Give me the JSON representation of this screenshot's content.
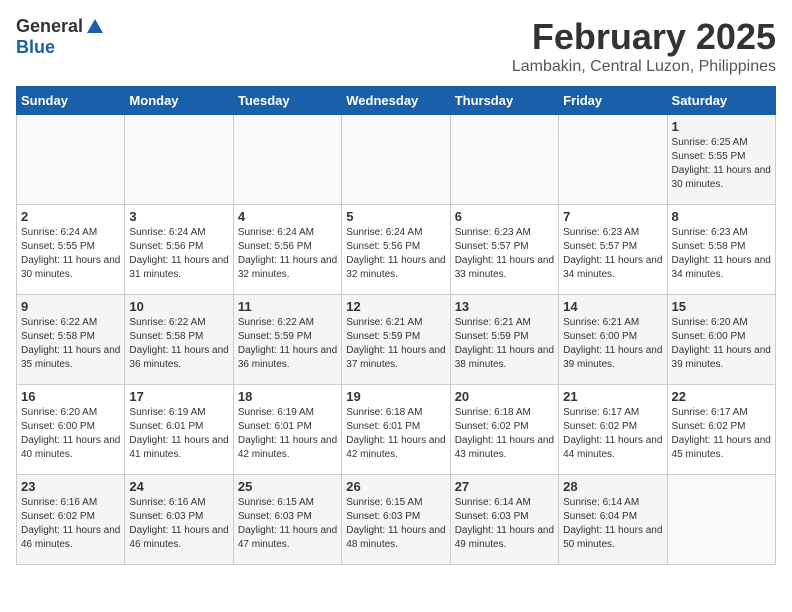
{
  "header": {
    "logo_general": "General",
    "logo_blue": "Blue",
    "month": "February 2025",
    "location": "Lambakin, Central Luzon, Philippines"
  },
  "days_of_week": [
    "Sunday",
    "Monday",
    "Tuesday",
    "Wednesday",
    "Thursday",
    "Friday",
    "Saturday"
  ],
  "weeks": [
    [
      {
        "day": "",
        "sunrise": "",
        "sunset": "",
        "daylight": ""
      },
      {
        "day": "",
        "sunrise": "",
        "sunset": "",
        "daylight": ""
      },
      {
        "day": "",
        "sunrise": "",
        "sunset": "",
        "daylight": ""
      },
      {
        "day": "",
        "sunrise": "",
        "sunset": "",
        "daylight": ""
      },
      {
        "day": "",
        "sunrise": "",
        "sunset": "",
        "daylight": ""
      },
      {
        "day": "",
        "sunrise": "",
        "sunset": "",
        "daylight": ""
      },
      {
        "day": "1",
        "sunrise": "6:25 AM",
        "sunset": "5:55 PM",
        "daylight": "11 hours and 30 minutes."
      }
    ],
    [
      {
        "day": "2",
        "sunrise": "6:24 AM",
        "sunset": "5:55 PM",
        "daylight": "11 hours and 30 minutes."
      },
      {
        "day": "3",
        "sunrise": "6:24 AM",
        "sunset": "5:56 PM",
        "daylight": "11 hours and 31 minutes."
      },
      {
        "day": "4",
        "sunrise": "6:24 AM",
        "sunset": "5:56 PM",
        "daylight": "11 hours and 32 minutes."
      },
      {
        "day": "5",
        "sunrise": "6:24 AM",
        "sunset": "5:56 PM",
        "daylight": "11 hours and 32 minutes."
      },
      {
        "day": "6",
        "sunrise": "6:23 AM",
        "sunset": "5:57 PM",
        "daylight": "11 hours and 33 minutes."
      },
      {
        "day": "7",
        "sunrise": "6:23 AM",
        "sunset": "5:57 PM",
        "daylight": "11 hours and 34 minutes."
      },
      {
        "day": "8",
        "sunrise": "6:23 AM",
        "sunset": "5:58 PM",
        "daylight": "11 hours and 34 minutes."
      }
    ],
    [
      {
        "day": "9",
        "sunrise": "6:22 AM",
        "sunset": "5:58 PM",
        "daylight": "11 hours and 35 minutes."
      },
      {
        "day": "10",
        "sunrise": "6:22 AM",
        "sunset": "5:58 PM",
        "daylight": "11 hours and 36 minutes."
      },
      {
        "day": "11",
        "sunrise": "6:22 AM",
        "sunset": "5:59 PM",
        "daylight": "11 hours and 36 minutes."
      },
      {
        "day": "12",
        "sunrise": "6:21 AM",
        "sunset": "5:59 PM",
        "daylight": "11 hours and 37 minutes."
      },
      {
        "day": "13",
        "sunrise": "6:21 AM",
        "sunset": "5:59 PM",
        "daylight": "11 hours and 38 minutes."
      },
      {
        "day": "14",
        "sunrise": "6:21 AM",
        "sunset": "6:00 PM",
        "daylight": "11 hours and 39 minutes."
      },
      {
        "day": "15",
        "sunrise": "6:20 AM",
        "sunset": "6:00 PM",
        "daylight": "11 hours and 39 minutes."
      }
    ],
    [
      {
        "day": "16",
        "sunrise": "6:20 AM",
        "sunset": "6:00 PM",
        "daylight": "11 hours and 40 minutes."
      },
      {
        "day": "17",
        "sunrise": "6:19 AM",
        "sunset": "6:01 PM",
        "daylight": "11 hours and 41 minutes."
      },
      {
        "day": "18",
        "sunrise": "6:19 AM",
        "sunset": "6:01 PM",
        "daylight": "11 hours and 42 minutes."
      },
      {
        "day": "19",
        "sunrise": "6:18 AM",
        "sunset": "6:01 PM",
        "daylight": "11 hours and 42 minutes."
      },
      {
        "day": "20",
        "sunrise": "6:18 AM",
        "sunset": "6:02 PM",
        "daylight": "11 hours and 43 minutes."
      },
      {
        "day": "21",
        "sunrise": "6:17 AM",
        "sunset": "6:02 PM",
        "daylight": "11 hours and 44 minutes."
      },
      {
        "day": "22",
        "sunrise": "6:17 AM",
        "sunset": "6:02 PM",
        "daylight": "11 hours and 45 minutes."
      }
    ],
    [
      {
        "day": "23",
        "sunrise": "6:16 AM",
        "sunset": "6:02 PM",
        "daylight": "11 hours and 46 minutes."
      },
      {
        "day": "24",
        "sunrise": "6:16 AM",
        "sunset": "6:03 PM",
        "daylight": "11 hours and 46 minutes."
      },
      {
        "day": "25",
        "sunrise": "6:15 AM",
        "sunset": "6:03 PM",
        "daylight": "11 hours and 47 minutes."
      },
      {
        "day": "26",
        "sunrise": "6:15 AM",
        "sunset": "6:03 PM",
        "daylight": "11 hours and 48 minutes."
      },
      {
        "day": "27",
        "sunrise": "6:14 AM",
        "sunset": "6:03 PM",
        "daylight": "11 hours and 49 minutes."
      },
      {
        "day": "28",
        "sunrise": "6:14 AM",
        "sunset": "6:04 PM",
        "daylight": "11 hours and 50 minutes."
      },
      {
        "day": "",
        "sunrise": "",
        "sunset": "",
        "daylight": ""
      }
    ]
  ]
}
